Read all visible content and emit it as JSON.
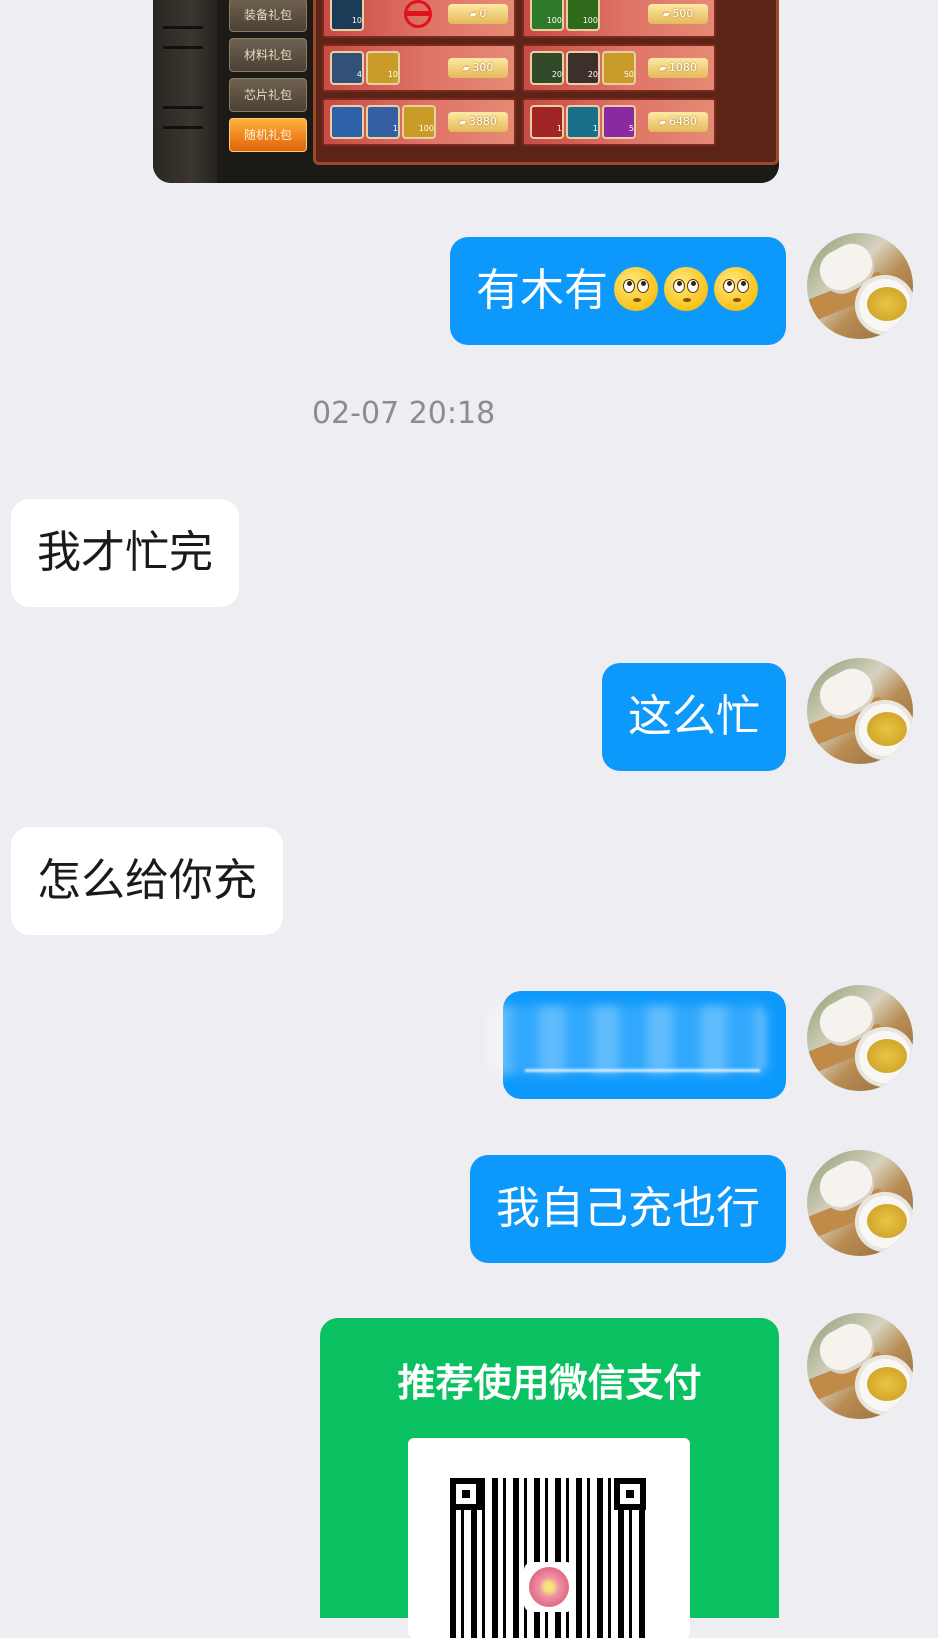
{
  "game_screenshot": {
    "menu": [
      "装备礼包",
      "材料礼包",
      "芯片礼包",
      "随机礼包"
    ],
    "active_menu": "随机礼包",
    "cells": [
      {
        "items": [
          {
            "color": "#1b3c57",
            "count": "10"
          }
        ],
        "price": "0",
        "blocked": true
      },
      {
        "items": [
          {
            "color": "#2f7a2a",
            "count": "100"
          },
          {
            "color": "#2f6a1a",
            "count": "100"
          }
        ],
        "price": "500"
      },
      {
        "items": [
          {
            "color": "#325078",
            "count": "4"
          },
          {
            "color": "#c99c2a",
            "count": "10"
          }
        ],
        "price": "300"
      },
      {
        "items": [
          {
            "color": "#324a28",
            "count": "20"
          },
          {
            "color": "#3f2f2a",
            "count": "20"
          },
          {
            "color": "#c99c2a",
            "count": "50"
          }
        ],
        "price": "1080"
      },
      {
        "items": [
          {
            "color": "#2e62a8",
            "count": ""
          },
          {
            "color": "#355fa3",
            "count": "1"
          },
          {
            "color": "#c99c2a",
            "count": "100"
          }
        ],
        "price": "3880"
      },
      {
        "items": [
          {
            "color": "#a02424",
            "count": "1"
          },
          {
            "color": "#1a6e8a",
            "count": "1"
          },
          {
            "color": "#8a2aa0",
            "count": "5"
          }
        ],
        "price": "6480"
      }
    ]
  },
  "messages": {
    "m1_text": "有木有",
    "timestamp": "02-07 20:18",
    "m2_text": "我才忙完",
    "m3_text": "这么忙",
    "m4_text": "怎么给你充",
    "m6_text": "我自己充也行",
    "pay_title": "推荐使用微信支付"
  },
  "colors": {
    "outgoing_bubble": "#0d99fc",
    "incoming_bubble": "#ffffff",
    "background": "#ededf2",
    "wechat_green": "#09c160"
  }
}
